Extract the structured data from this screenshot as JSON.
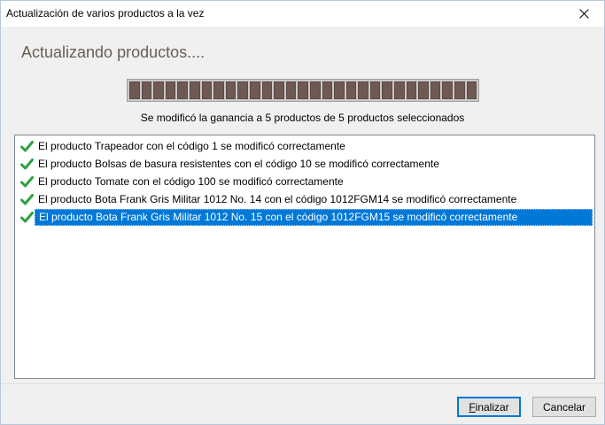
{
  "window": {
    "title": "Actualización de varios productos a la vez"
  },
  "main": {
    "heading": "Actualizando productos....",
    "progress": {
      "value": 1.0,
      "segments": 29
    },
    "summary": "Se modificó la ganancia a 5 productos de 5 productos seleccionados"
  },
  "log": {
    "items": [
      {
        "text": "El producto Trapeador con el código 1 se modificó correctamente",
        "checked": true,
        "selected": false
      },
      {
        "text": "El producto Bolsas de basura resistentes con el código 10 se modificó correctamente",
        "checked": true,
        "selected": false
      },
      {
        "text": "El producto Tomate con el código 100 se modificó correctamente",
        "checked": true,
        "selected": false
      },
      {
        "text": "El producto Bota Frank Gris Militar 1012 No. 14 con el código 1012FGM14 se modificó correctamente",
        "checked": true,
        "selected": false
      },
      {
        "text": "El producto Bota Frank Gris Militar 1012 No. 15 con el código 1012FGM15 se modificó correctamente",
        "checked": true,
        "selected": true
      }
    ]
  },
  "footer": {
    "finalizar_access": "F",
    "finalizar_rest": "inalizar",
    "cancelar": "Cancelar"
  },
  "colors": {
    "selection": "#0078d7",
    "check": "#2ea043",
    "progress_fill": "#6e5a52",
    "heading": "#6a5e54"
  }
}
